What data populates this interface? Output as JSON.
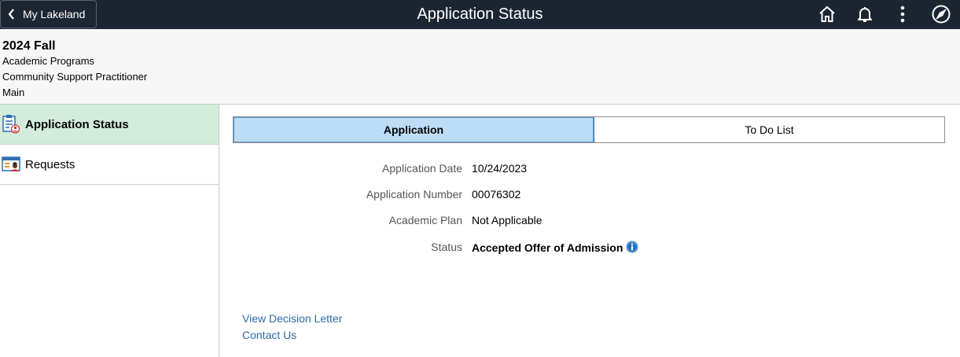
{
  "topbar": {
    "back_label": "My Lakeland",
    "title": "Application Status",
    "icons": [
      "home-icon",
      "bell-icon",
      "more-vertical-icon",
      "compass-icon"
    ]
  },
  "header": {
    "term": "2024 Fall",
    "career": "Academic Programs",
    "program": "Community Support Practitioner",
    "campus": "Main"
  },
  "sidebar": {
    "items": [
      {
        "label": "Application Status",
        "icon": "application-status-icon",
        "active": true
      },
      {
        "label": "Requests",
        "icon": "requests-icon",
        "active": false
      }
    ]
  },
  "tabs": [
    {
      "label": "Application",
      "active": true
    },
    {
      "label": "To Do List",
      "active": false
    }
  ],
  "details": {
    "application_date_label": "Application Date",
    "application_date": "10/24/2023",
    "application_number_label": "Application Number",
    "application_number": "00076302",
    "academic_plan_label": "Academic Plan",
    "academic_plan": "Not Applicable",
    "status_label": "Status",
    "status": "Accepted Offer of Admission"
  },
  "links": {
    "decision_letter": "View Decision Letter",
    "contact_us": "Contact Us"
  },
  "colors": {
    "banner": "#1c2633",
    "active_nav": "#d3ecdc",
    "active_tab": "#bddcf6",
    "link": "#2d6ba8",
    "info": "#1f6fc0"
  }
}
